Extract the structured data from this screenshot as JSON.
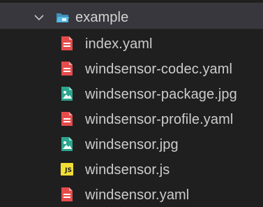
{
  "explorer": {
    "folder": {
      "name": "example",
      "expanded": true,
      "icon": "folder-open-icon",
      "icon_color": "#44a9d6"
    },
    "files": [
      {
        "name": "index.yaml",
        "icon": "yaml-file-icon",
        "color": "#e44c4c"
      },
      {
        "name": "windsensor-codec.yaml",
        "icon": "yaml-file-icon",
        "color": "#e44c4c"
      },
      {
        "name": "windsensor-package.jpg",
        "icon": "image-file-icon",
        "color": "#2ea58e"
      },
      {
        "name": "windsensor-profile.yaml",
        "icon": "yaml-file-icon",
        "color": "#e44c4c"
      },
      {
        "name": "windsensor.jpg",
        "icon": "image-file-icon",
        "color": "#2ea58e"
      },
      {
        "name": "windsensor.js",
        "icon": "js-file-icon",
        "color": "#f1dd35",
        "badge": "JS"
      },
      {
        "name": "windsensor.yaml",
        "icon": "yaml-file-icon",
        "color": "#e44c4c"
      }
    ]
  }
}
